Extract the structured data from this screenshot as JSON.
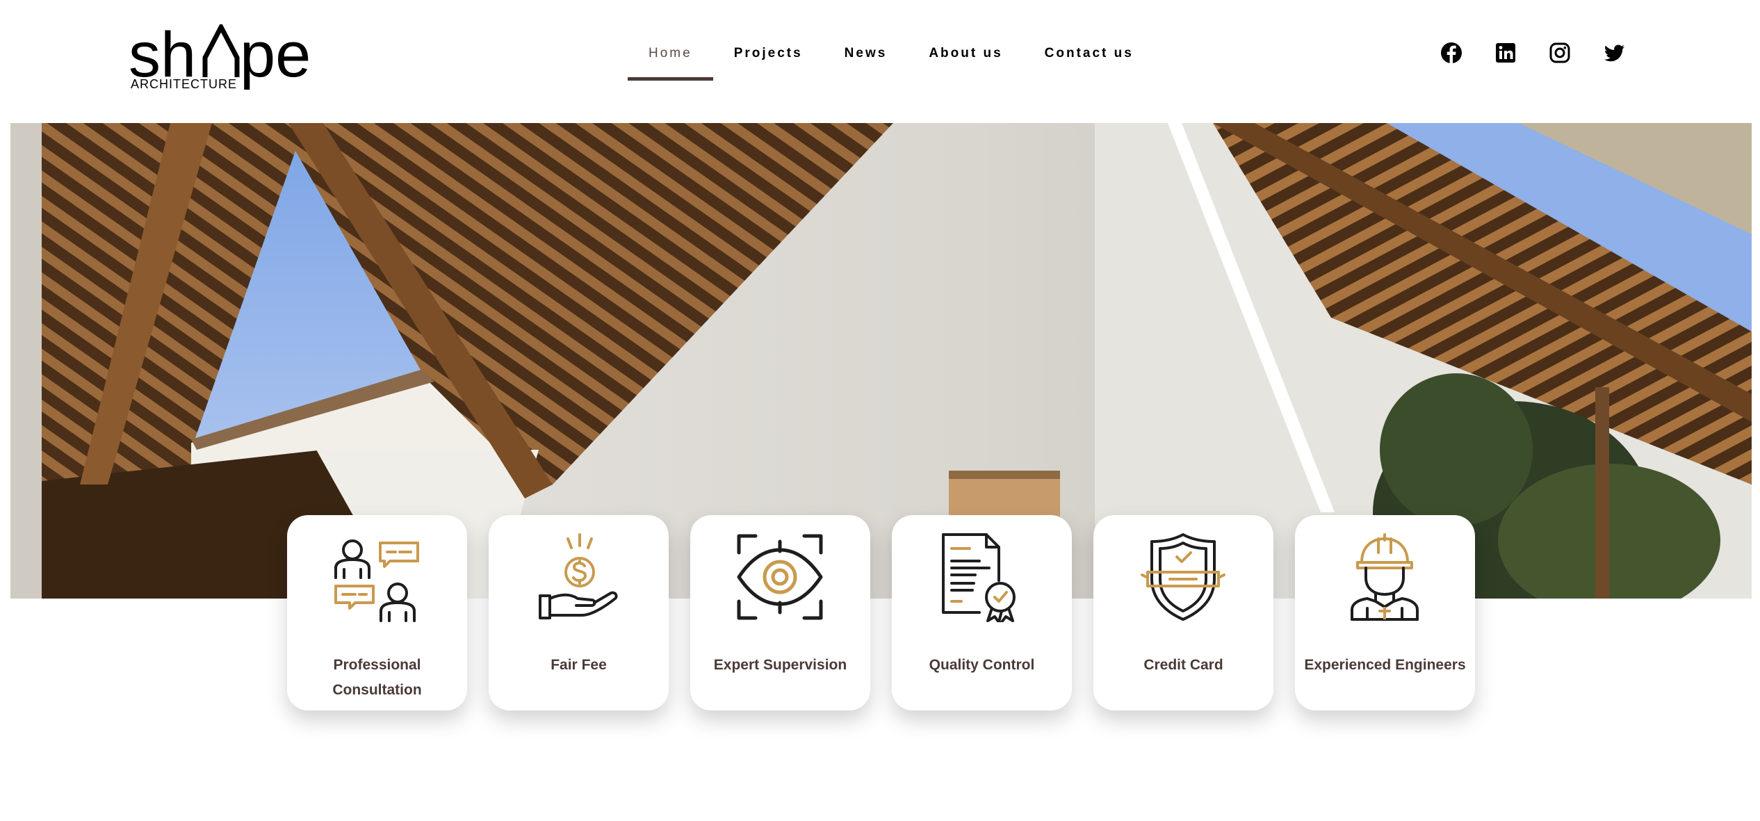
{
  "brand": {
    "name_start": "sh",
    "name_end": "pe",
    "tagline": "ARCHITECTURE"
  },
  "nav": {
    "items": [
      {
        "label": "Home",
        "active": true
      },
      {
        "label": "Projects",
        "active": false
      },
      {
        "label": "News",
        "active": false
      },
      {
        "label": "About us",
        "active": false
      },
      {
        "label": "Contact us",
        "active": false
      }
    ]
  },
  "socials": [
    {
      "icon": "facebook-icon"
    },
    {
      "icon": "linkedin-icon"
    },
    {
      "icon": "instagram-icon"
    },
    {
      "icon": "twitter-icon"
    }
  ],
  "features": [
    {
      "label": "Professional Consultation",
      "icon": "consultation-icon"
    },
    {
      "label": "Fair Fee",
      "icon": "fair-fee-icon"
    },
    {
      "label": "Expert Supervision",
      "icon": "supervision-eye-icon"
    },
    {
      "label": "Quality Control",
      "icon": "quality-certificate-icon"
    },
    {
      "label": "Credit Card",
      "icon": "shield-card-icon"
    },
    {
      "label": "Experienced Engineers",
      "icon": "engineer-icon"
    }
  ],
  "colors": {
    "accent": "#c99a4e",
    "text_dark": "#4a3a36",
    "nav_underline": "#4a3a36"
  }
}
